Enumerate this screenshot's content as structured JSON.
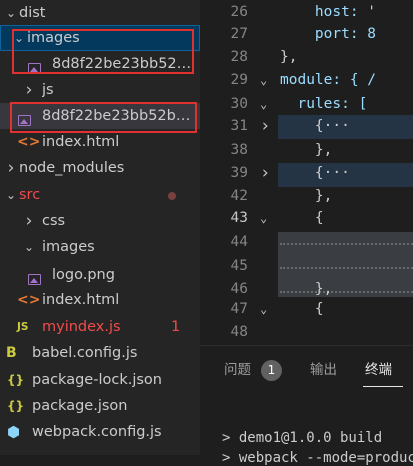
{
  "explorer": {
    "items": [
      {
        "label": "dist",
        "chevron": "⌄",
        "icon": "chevron-down",
        "color": "#cccccc"
      },
      {
        "label": "images",
        "chevron": "⌄",
        "icon": "chevron-down",
        "color": "#cccccc"
      },
      {
        "label": "8d8f22be23bb52b...",
        "icon": "image-file",
        "color": "#cccccc"
      },
      {
        "label": "js",
        "chevron": "›",
        "icon": "chevron-right",
        "color": "#cccccc"
      },
      {
        "label": "8d8f22be23bb52b5...",
        "icon": "image-file",
        "color": "#cccccc"
      },
      {
        "label": "index.html",
        "icon": "html-file",
        "glyph": "<>",
        "color": "#cccccc"
      },
      {
        "label": "node_modules",
        "chevron": "›",
        "icon": "chevron-right",
        "color": "#cccccc"
      },
      {
        "label": "src",
        "chevron": "⌄",
        "icon": "chevron-down",
        "color": "#f14c4c"
      },
      {
        "label": "css",
        "chevron": "›",
        "icon": "chevron-right",
        "color": "#cccccc"
      },
      {
        "label": "images",
        "chevron": "⌄",
        "icon": "chevron-down",
        "color": "#cccccc"
      },
      {
        "label": "logo.png",
        "icon": "image-file",
        "color": "#cccccc"
      },
      {
        "label": "index.html",
        "icon": "html-file",
        "glyph": "<>",
        "color": "#cccccc"
      },
      {
        "label": "myindex.js",
        "icon": "js-file",
        "glyph": "JS",
        "color": "#f14c4c",
        "badge": "1"
      },
      {
        "label": "babel.config.js",
        "icon": "babel-file",
        "glyph": "B",
        "color": "#cccccc"
      },
      {
        "label": "package-lock.json",
        "icon": "json-file",
        "glyph": "{}",
        "color": "#cccccc"
      },
      {
        "label": "package.json",
        "icon": "json-file",
        "glyph": "{}",
        "color": "#cccccc"
      },
      {
        "label": "webpack.config.js",
        "icon": "webpack-file",
        "glyph": "⬢",
        "color": "#cccccc"
      }
    ]
  },
  "editor": {
    "lines": [
      {
        "num": "26",
        "fold": "",
        "text": "    host: '",
        "color": "#9cdcfe"
      },
      {
        "num": "27",
        "fold": "",
        "text": "    port: 8",
        "color": "#9cdcfe"
      },
      {
        "num": "28",
        "fold": "",
        "text": "},",
        "color": "#cccccc"
      },
      {
        "num": "29",
        "fold": "⌄",
        "text": "module: { /",
        "color": "#9cdcfe"
      },
      {
        "num": "30",
        "fold": "⌄",
        "text": "  rules: [",
        "color": "#9cdcfe"
      },
      {
        "num": "31",
        "fold": "›",
        "text": "    {···",
        "color": "#cccccc"
      },
      {
        "num": "38",
        "fold": "",
        "text": "    },",
        "color": "#cccccc"
      },
      {
        "num": "39",
        "fold": "›",
        "text": "    {···",
        "color": "#cccccc"
      },
      {
        "num": "42",
        "fold": "",
        "text": "    },",
        "color": "#cccccc"
      },
      {
        "num": "43",
        "fold": "⌄",
        "text": "    {",
        "color": "#cccccc"
      },
      {
        "num": "44",
        "fold": "",
        "text": "",
        "color": "#cccccc"
      },
      {
        "num": "45",
        "fold": "",
        "text": "",
        "color": "#cccccc"
      },
      {
        "num": "46",
        "fold": "",
        "text": "    },",
        "color": "#cccccc"
      },
      {
        "num": "47",
        "fold": "⌄",
        "text": "    {",
        "color": "#cccccc"
      },
      {
        "num": "48",
        "fold": "",
        "text": "",
        "color": "#cccccc"
      }
    ]
  },
  "panel": {
    "tabs": [
      "问题",
      "输出",
      "终端"
    ],
    "problems_count": "1",
    "terminal_line": "> demo1@1.0.0 build",
    "terminal_line2": "> webpack --mode=product"
  },
  "colors": {
    "annotation_box": "#e03131",
    "modified_dot": "#7a4040"
  }
}
